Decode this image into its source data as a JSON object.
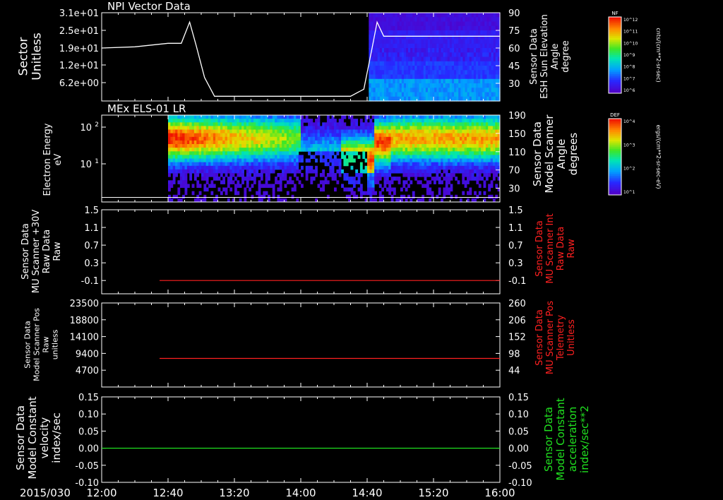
{
  "time_axis": {
    "date_label": "2015/030",
    "ticks": [
      "12:00",
      "12:40",
      "13:20",
      "14:00",
      "14:40",
      "15:20",
      "16:00"
    ]
  },
  "chart_data": [
    {
      "type": "line",
      "title": "NPI Vector Data",
      "ylabel_left": [
        "Sector",
        "Unitless"
      ],
      "ylabel_right": [
        "Sensor Data",
        "ESH Sun Elevation",
        "Angle",
        "degree"
      ],
      "yticks_left": [
        "3.1e+01",
        "2.5e+01",
        "1.9e+01",
        "1.2e+01",
        "6.2e+00"
      ],
      "yticks_right": [
        "90",
        "75",
        "60",
        "45",
        "30"
      ],
      "ylim_right": [
        15,
        90
      ],
      "x": [
        "12:00",
        "12:20",
        "12:40",
        "12:48",
        "12:53",
        "12:57",
        "13:02",
        "13:08",
        "13:20",
        "14:00",
        "14:30",
        "14:38",
        "14:43",
        "14:46",
        "14:50",
        "15:00",
        "16:00"
      ],
      "y": [
        60,
        61,
        64,
        64,
        82,
        62,
        35,
        19,
        19,
        19,
        19,
        25,
        60,
        82,
        70,
        70,
        70
      ],
      "colorbar": {
        "label": "NF",
        "units": "cnts/(cm**2-sr-sec)",
        "ticks": [
          "10^12",
          "10^11",
          "10^10",
          "10^9",
          "10^8",
          "10^7",
          "10^6"
        ]
      },
      "heatmap_start": "14:41",
      "color": "#ffffff"
    },
    {
      "type": "heatmap",
      "title": "MEx ELS-01 LR",
      "ylabel_left": [
        "Electron Energy",
        "eV"
      ],
      "ylabel_right": [
        "Sensor Data",
        "Model Scanner",
        "Angle",
        "degrees"
      ],
      "yticks_left": [
        "10^2",
        "10^1"
      ],
      "yticks_right": [
        "190",
        "150",
        "110",
        "70",
        "30"
      ],
      "ylim_right": [
        0,
        190
      ],
      "data_start": "12:40",
      "colorbar": {
        "label": "DEF",
        "units": "ergs/(cm**2-sr-sec-eV)",
        "ticks": [
          "10^4",
          "10^3",
          "10^2",
          "10^1"
        ]
      },
      "line_value": 10
    },
    {
      "type": "line",
      "ylabel_left": [
        "Sensor Data",
        "MU Scanner +30V",
        "Raw Data",
        "Raw"
      ],
      "ylabel_right": [
        "Sensor Data",
        "MU Scanner Int",
        "Raw Data",
        "Raw"
      ],
      "yticks": [
        "1.5",
        "1.1",
        "0.7",
        "0.3",
        "-0.1"
      ],
      "ylim": [
        -0.4,
        1.5
      ],
      "x": [
        "12:40",
        "16:00"
      ],
      "y": [
        -0.1,
        -0.1
      ],
      "color": "#ff2020"
    },
    {
      "type": "line",
      "ylabel_left": [
        "Sensor Data",
        "Model Scanner Pos",
        "Raw",
        "unitless"
      ],
      "ylabel_right": [
        "Sensor Data",
        "MU Scanner Pos",
        "Telemetry",
        "Unitless"
      ],
      "yticks_left": [
        "23500",
        "18800",
        "14100",
        "9400",
        "4700"
      ],
      "yticks_right": [
        "260",
        "206",
        "152",
        "98",
        "44"
      ],
      "ylim_left": [
        0,
        23500
      ],
      "x": [
        "12:40",
        "16:00"
      ],
      "y": [
        8000,
        8000
      ],
      "color": "#ff2020"
    },
    {
      "type": "line",
      "ylabel_left": [
        "Sensor Data",
        "Model Constant",
        "velocity",
        "index/sec"
      ],
      "ylabel_right": [
        "Sensor Data",
        "Model Constant",
        "acceleration",
        "index/sec**2"
      ],
      "yticks": [
        "0.15",
        "0.10",
        "0.05",
        "0.00",
        "-0.05",
        "-0.10"
      ],
      "ylim": [
        -0.1,
        0.15
      ],
      "x": [
        "12:00",
        "16:00"
      ],
      "y": [
        0.0,
        0.0
      ],
      "color": "#20e020"
    }
  ]
}
